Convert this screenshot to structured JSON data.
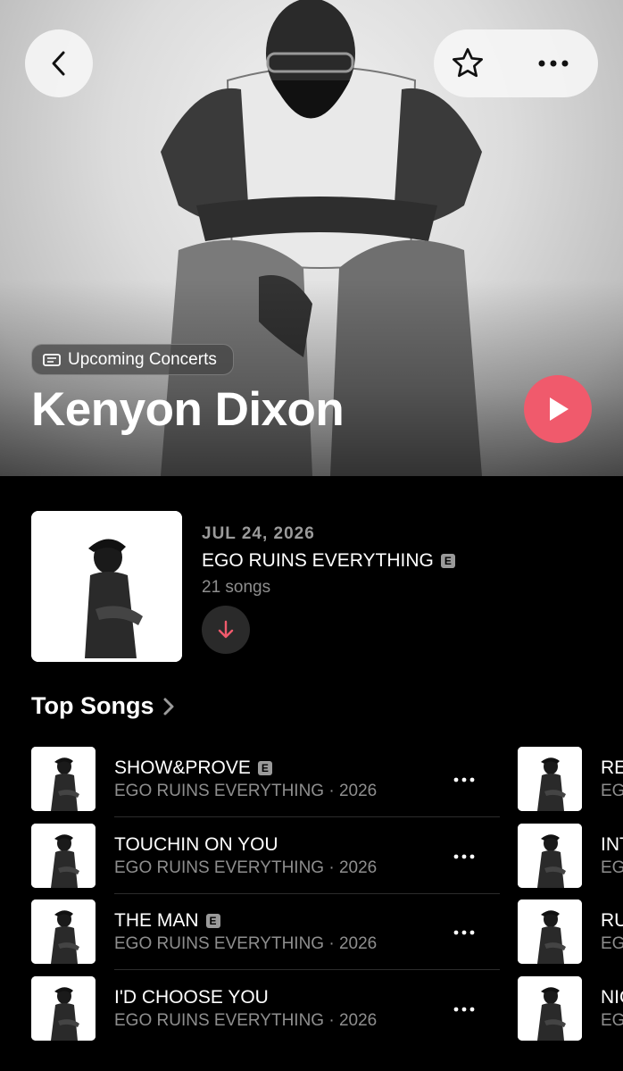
{
  "header": {
    "concert_chip": "Upcoming Concerts",
    "artist_name": "Kenyon Dixon"
  },
  "latest_release": {
    "date": "JUL 24, 2026",
    "title": "EGO RUINS EVERYTHING",
    "explicit": "E",
    "song_count": "21 songs"
  },
  "top_songs": {
    "title": "Top Songs",
    "column1": [
      {
        "title": "SHOW&PROVE",
        "explicit": "E",
        "subtitle": "EGO RUINS EVERYTHING · 2026"
      },
      {
        "title": "TOUCHIN ON YOU",
        "explicit": "",
        "subtitle": "EGO RUINS EVERYTHING · 2026"
      },
      {
        "title": "THE MAN",
        "explicit": "E",
        "subtitle": "EGO RUINS EVERYTHING · 2026"
      },
      {
        "title": "I'D CHOOSE YOU",
        "explicit": "",
        "subtitle": "EGO RUINS EVERYTHING · 2026"
      }
    ],
    "column2": [
      {
        "title": "RE",
        "subtitle": "EG"
      },
      {
        "title": "INT",
        "subtitle": "EG"
      },
      {
        "title": "RU",
        "subtitle": "EG"
      },
      {
        "title": "NIC",
        "subtitle": "EG"
      }
    ]
  },
  "colors": {
    "accent": "#f05a6c",
    "background": "#000000",
    "secondary_text": "#8e8e8e"
  }
}
